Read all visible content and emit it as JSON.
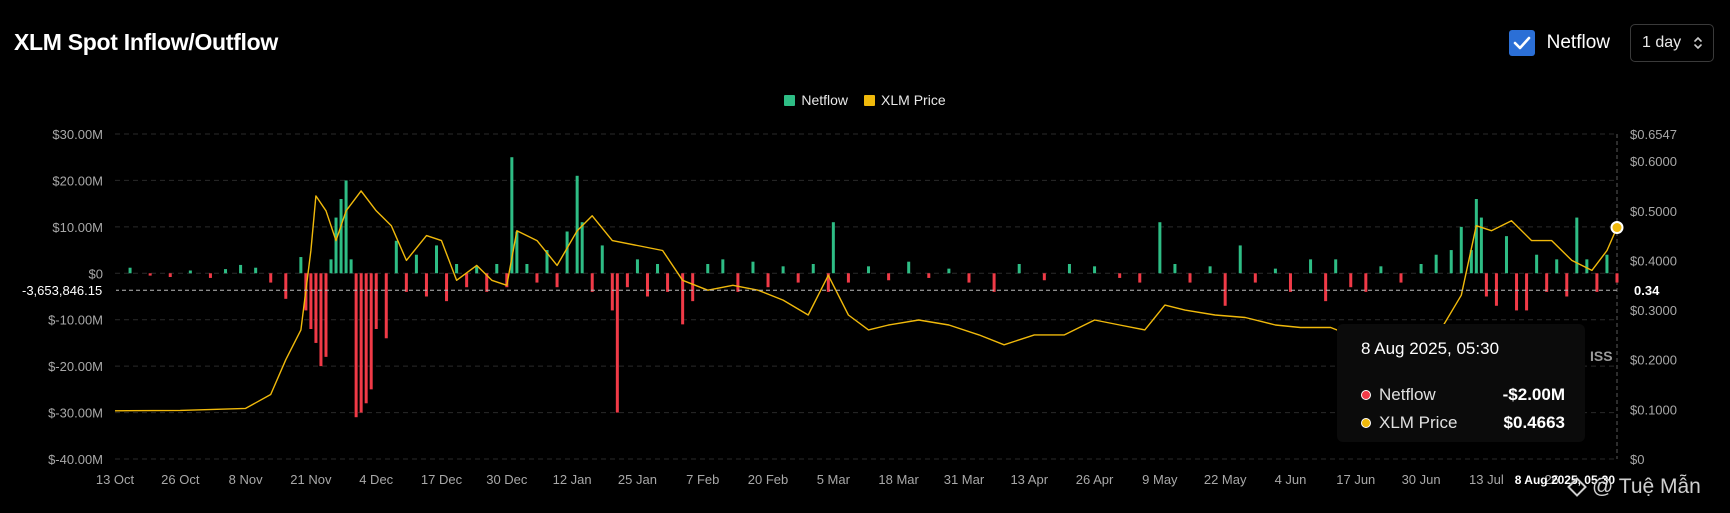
{
  "title": "XLM Spot Inflow/Outflow",
  "controls": {
    "checkbox_label": "Netflow",
    "checkbox_checked": true,
    "interval": "1 day"
  },
  "colors": {
    "positive": "#2ebd85",
    "negative": "#f03a47",
    "price": "#f0b90b",
    "accent": "#2b6fd6"
  },
  "tooltip": {
    "date": "8 Aug 2025, 05:30",
    "rows": [
      {
        "name": "Netflow",
        "value": "-$2.00M"
      },
      {
        "name": "XLM Price",
        "value": "$0.4663"
      }
    ]
  },
  "watermark": "@ Tuệ Mẫn",
  "partial_text": "ISS",
  "chart_data": {
    "type": "bar",
    "title": "XLM Spot Inflow/Outflow",
    "legend": [
      {
        "name": "Netflow",
        "color": "#2ebd85"
      },
      {
        "name": "XLM Price",
        "color": "#f0b90b"
      }
    ],
    "legend_position": "top-center",
    "grid": true,
    "x_range": [
      "2024-10-13",
      "2025-08-08"
    ],
    "x_ticks": [
      "13 Oct",
      "26 Oct",
      "8 Nov",
      "21 Nov",
      "4 Dec",
      "17 Dec",
      "30 Dec",
      "12 Jan",
      "25 Jan",
      "7 Feb",
      "20 Feb",
      "5 Mar",
      "18 Mar",
      "31 Mar",
      "13 Apr",
      "26 Apr",
      "9 May",
      "22 May",
      "4 Jun",
      "17 Jun",
      "30 Jun",
      "13 Jul",
      "26",
      "8 Aug 2025, 05:30"
    ],
    "y_left": {
      "ticks": [
        "$30.00M",
        "$20.00M",
        "$10.00M",
        "$0",
        "$-10.00M",
        "$-20.00M",
        "$-30.00M",
        "$-40.00M"
      ],
      "range": [
        -40,
        30
      ],
      "unit": "M"
    },
    "y_right": {
      "ticks": [
        "$0.6547",
        "$0.6000",
        "$0.5000",
        "$0.4000",
        "$0.3000",
        "$0.2000",
        "$0.1000",
        "$0"
      ],
      "range": [
        0,
        0.6547
      ]
    },
    "crosshair": {
      "left_label": "-3,653,846.15",
      "left_value": -3.65,
      "right_label": "0.34"
    },
    "netflow_series": [
      {
        "date": "2024-10-16",
        "value": 1.2
      },
      {
        "date": "2024-10-20",
        "value": -0.5
      },
      {
        "date": "2024-10-24",
        "value": -0.8
      },
      {
        "date": "2024-10-28",
        "value": 0.6
      },
      {
        "date": "2024-11-01",
        "value": -1.0
      },
      {
        "date": "2024-11-04",
        "value": 0.9
      },
      {
        "date": "2024-11-07",
        "value": 1.8
      },
      {
        "date": "2024-11-10",
        "value": 1.2
      },
      {
        "date": "2024-11-13",
        "value": -2.0
      },
      {
        "date": "2024-11-16",
        "value": -5.5
      },
      {
        "date": "2024-11-19",
        "value": 3.5
      },
      {
        "date": "2024-11-20",
        "value": -8.0
      },
      {
        "date": "2024-11-21",
        "value": -12.0
      },
      {
        "date": "2024-11-22",
        "value": -15.0
      },
      {
        "date": "2024-11-23",
        "value": -20.0
      },
      {
        "date": "2024-11-24",
        "value": -18.0
      },
      {
        "date": "2024-11-25",
        "value": 3.0
      },
      {
        "date": "2024-11-26",
        "value": 12.0
      },
      {
        "date": "2024-11-27",
        "value": 16.0
      },
      {
        "date": "2024-11-28",
        "value": 20.0
      },
      {
        "date": "2024-11-29",
        "value": 3.0
      },
      {
        "date": "2024-11-30",
        "value": -31.0
      },
      {
        "date": "2024-12-01",
        "value": -30.0
      },
      {
        "date": "2024-12-02",
        "value": -28.0
      },
      {
        "date": "2024-12-03",
        "value": -25.0
      },
      {
        "date": "2024-12-04",
        "value": -12.0
      },
      {
        "date": "2024-12-06",
        "value": -14.0
      },
      {
        "date": "2024-12-08",
        "value": 7.0
      },
      {
        "date": "2024-12-10",
        "value": -4.0
      },
      {
        "date": "2024-12-12",
        "value": 4.0
      },
      {
        "date": "2024-12-14",
        "value": -5.0
      },
      {
        "date": "2024-12-16",
        "value": 6.0
      },
      {
        "date": "2024-12-18",
        "value": -6.0
      },
      {
        "date": "2024-12-20",
        "value": 2.0
      },
      {
        "date": "2024-12-22",
        "value": -3.0
      },
      {
        "date": "2024-12-24",
        "value": 1.5
      },
      {
        "date": "2024-12-26",
        "value": -4.0
      },
      {
        "date": "2024-12-28",
        "value": 2.0
      },
      {
        "date": "2024-12-30",
        "value": -3.0
      },
      {
        "date": "2024-12-31",
        "value": 25.0
      },
      {
        "date": "2025-01-01",
        "value": 9.0
      },
      {
        "date": "2025-01-03",
        "value": 2.0
      },
      {
        "date": "2025-01-05",
        "value": -2.0
      },
      {
        "date": "2025-01-07",
        "value": 5.0
      },
      {
        "date": "2025-01-09",
        "value": -3.0
      },
      {
        "date": "2025-01-11",
        "value": 9.0
      },
      {
        "date": "2025-01-13",
        "value": 21.0
      },
      {
        "date": "2025-01-14",
        "value": 11.0
      },
      {
        "date": "2025-01-16",
        "value": -4.0
      },
      {
        "date": "2025-01-18",
        "value": 6.0
      },
      {
        "date": "2025-01-20",
        "value": -8.0
      },
      {
        "date": "2025-01-21",
        "value": -30.0
      },
      {
        "date": "2025-01-23",
        "value": -3.0
      },
      {
        "date": "2025-01-25",
        "value": 3.0
      },
      {
        "date": "2025-01-27",
        "value": -5.0
      },
      {
        "date": "2025-01-29",
        "value": 2.0
      },
      {
        "date": "2025-01-31",
        "value": -4.0
      },
      {
        "date": "2025-02-03",
        "value": -11.0
      },
      {
        "date": "2025-02-05",
        "value": -6.0
      },
      {
        "date": "2025-02-08",
        "value": 2.0
      },
      {
        "date": "2025-02-11",
        "value": 3.0
      },
      {
        "date": "2025-02-14",
        "value": -4.0
      },
      {
        "date": "2025-02-17",
        "value": 2.5
      },
      {
        "date": "2025-02-20",
        "value": -3.0
      },
      {
        "date": "2025-02-23",
        "value": 1.5
      },
      {
        "date": "2025-02-26",
        "value": -2.0
      },
      {
        "date": "2025-03-01",
        "value": 2.0
      },
      {
        "date": "2025-03-04",
        "value": -4.0
      },
      {
        "date": "2025-03-05",
        "value": 11.0
      },
      {
        "date": "2025-03-08",
        "value": -2.0
      },
      {
        "date": "2025-03-12",
        "value": 1.5
      },
      {
        "date": "2025-03-16",
        "value": -1.5
      },
      {
        "date": "2025-03-20",
        "value": 2.5
      },
      {
        "date": "2025-03-24",
        "value": -1.0
      },
      {
        "date": "2025-03-28",
        "value": 1.0
      },
      {
        "date": "2025-04-01",
        "value": -2.0
      },
      {
        "date": "2025-04-06",
        "value": -4.0
      },
      {
        "date": "2025-04-11",
        "value": 2.0
      },
      {
        "date": "2025-04-16",
        "value": -1.5
      },
      {
        "date": "2025-04-21",
        "value": 2.0
      },
      {
        "date": "2025-04-26",
        "value": 1.5
      },
      {
        "date": "2025-05-01",
        "value": -1.0
      },
      {
        "date": "2025-05-05",
        "value": -2.0
      },
      {
        "date": "2025-05-09",
        "value": 11.0
      },
      {
        "date": "2025-05-12",
        "value": 2.0
      },
      {
        "date": "2025-05-15",
        "value": -2.0
      },
      {
        "date": "2025-05-19",
        "value": 1.5
      },
      {
        "date": "2025-05-22",
        "value": -7.0
      },
      {
        "date": "2025-05-25",
        "value": 6.0
      },
      {
        "date": "2025-05-28",
        "value": -2.0
      },
      {
        "date": "2025-06-01",
        "value": 1.0
      },
      {
        "date": "2025-06-04",
        "value": -4.0
      },
      {
        "date": "2025-06-08",
        "value": 3.0
      },
      {
        "date": "2025-06-11",
        "value": -6.0
      },
      {
        "date": "2025-06-13",
        "value": 3.0
      },
      {
        "date": "2025-06-16",
        "value": -3.0
      },
      {
        "date": "2025-06-19",
        "value": -4.0
      },
      {
        "date": "2025-06-22",
        "value": 1.5
      },
      {
        "date": "2025-06-26",
        "value": -2.0
      },
      {
        "date": "2025-06-30",
        "value": 2.0
      },
      {
        "date": "2025-07-03",
        "value": 4.0
      },
      {
        "date": "2025-07-06",
        "value": 5.0
      },
      {
        "date": "2025-07-08",
        "value": 10.0
      },
      {
        "date": "2025-07-10",
        "value": 5.0
      },
      {
        "date": "2025-07-11",
        "value": 16.0
      },
      {
        "date": "2025-07-12",
        "value": 12.0
      },
      {
        "date": "2025-07-13",
        "value": -5.0
      },
      {
        "date": "2025-07-15",
        "value": -7.0
      },
      {
        "date": "2025-07-17",
        "value": 8.0
      },
      {
        "date": "2025-07-19",
        "value": -8.0
      },
      {
        "date": "2025-07-21",
        "value": -8.0
      },
      {
        "date": "2025-07-23",
        "value": 4.0
      },
      {
        "date": "2025-07-25",
        "value": -4.0
      },
      {
        "date": "2025-07-27",
        "value": 3.0
      },
      {
        "date": "2025-07-29",
        "value": -5.0
      },
      {
        "date": "2025-07-31",
        "value": 12.0
      },
      {
        "date": "2025-08-02",
        "value": 3.0
      },
      {
        "date": "2025-08-04",
        "value": -4.0
      },
      {
        "date": "2025-08-06",
        "value": 4.0
      },
      {
        "date": "2025-08-08",
        "value": -2.0
      }
    ],
    "price_series": [
      {
        "date": "2024-10-13",
        "value": 0.097
      },
      {
        "date": "2024-10-26",
        "value": 0.098
      },
      {
        "date": "2024-11-08",
        "value": 0.102
      },
      {
        "date": "2024-11-13",
        "value": 0.13
      },
      {
        "date": "2024-11-16",
        "value": 0.2
      },
      {
        "date": "2024-11-19",
        "value": 0.26
      },
      {
        "date": "2024-11-21",
        "value": 0.42
      },
      {
        "date": "2024-11-22",
        "value": 0.53
      },
      {
        "date": "2024-11-24",
        "value": 0.5
      },
      {
        "date": "2024-11-26",
        "value": 0.44
      },
      {
        "date": "2024-11-28",
        "value": 0.5
      },
      {
        "date": "2024-12-01",
        "value": 0.54
      },
      {
        "date": "2024-12-04",
        "value": 0.5
      },
      {
        "date": "2024-12-07",
        "value": 0.47
      },
      {
        "date": "2024-12-10",
        "value": 0.4
      },
      {
        "date": "2024-12-14",
        "value": 0.45
      },
      {
        "date": "2024-12-17",
        "value": 0.44
      },
      {
        "date": "2024-12-20",
        "value": 0.36
      },
      {
        "date": "2024-12-24",
        "value": 0.39
      },
      {
        "date": "2024-12-27",
        "value": 0.36
      },
      {
        "date": "2024-12-30",
        "value": 0.35
      },
      {
        "date": "2025-01-01",
        "value": 0.46
      },
      {
        "date": "2025-01-05",
        "value": 0.44
      },
      {
        "date": "2025-01-09",
        "value": 0.39
      },
      {
        "date": "2025-01-13",
        "value": 0.46
      },
      {
        "date": "2025-01-16",
        "value": 0.49
      },
      {
        "date": "2025-01-20",
        "value": 0.44
      },
      {
        "date": "2025-01-25",
        "value": 0.43
      },
      {
        "date": "2025-01-30",
        "value": 0.42
      },
      {
        "date": "2025-02-03",
        "value": 0.36
      },
      {
        "date": "2025-02-08",
        "value": 0.34
      },
      {
        "date": "2025-02-13",
        "value": 0.35
      },
      {
        "date": "2025-02-18",
        "value": 0.34
      },
      {
        "date": "2025-02-23",
        "value": 0.32
      },
      {
        "date": "2025-02-28",
        "value": 0.29
      },
      {
        "date": "2025-03-04",
        "value": 0.37
      },
      {
        "date": "2025-03-08",
        "value": 0.29
      },
      {
        "date": "2025-03-12",
        "value": 0.26
      },
      {
        "date": "2025-03-16",
        "value": 0.27
      },
      {
        "date": "2025-03-22",
        "value": 0.28
      },
      {
        "date": "2025-03-28",
        "value": 0.27
      },
      {
        "date": "2025-04-03",
        "value": 0.25
      },
      {
        "date": "2025-04-08",
        "value": 0.23
      },
      {
        "date": "2025-04-14",
        "value": 0.25
      },
      {
        "date": "2025-04-20",
        "value": 0.25
      },
      {
        "date": "2025-04-26",
        "value": 0.28
      },
      {
        "date": "2025-05-01",
        "value": 0.27
      },
      {
        "date": "2025-05-06",
        "value": 0.26
      },
      {
        "date": "2025-05-10",
        "value": 0.31
      },
      {
        "date": "2025-05-14",
        "value": 0.3
      },
      {
        "date": "2025-05-20",
        "value": 0.29
      },
      {
        "date": "2025-05-26",
        "value": 0.285
      },
      {
        "date": "2025-06-01",
        "value": 0.27
      },
      {
        "date": "2025-06-06",
        "value": 0.265
      },
      {
        "date": "2025-06-12",
        "value": 0.265
      },
      {
        "date": "2025-06-17",
        "value": 0.245
      },
      {
        "date": "2025-06-22",
        "value": 0.235
      },
      {
        "date": "2025-06-27",
        "value": 0.235
      },
      {
        "date": "2025-07-03",
        "value": 0.245
      },
      {
        "date": "2025-07-08",
        "value": 0.33
      },
      {
        "date": "2025-07-11",
        "value": 0.47
      },
      {
        "date": "2025-07-14",
        "value": 0.46
      },
      {
        "date": "2025-07-18",
        "value": 0.48
      },
      {
        "date": "2025-07-22",
        "value": 0.44
      },
      {
        "date": "2025-07-26",
        "value": 0.44
      },
      {
        "date": "2025-07-30",
        "value": 0.4
      },
      {
        "date": "2025-08-03",
        "value": 0.38
      },
      {
        "date": "2025-08-06",
        "value": 0.42
      },
      {
        "date": "2025-08-08",
        "value": 0.4663
      }
    ]
  }
}
